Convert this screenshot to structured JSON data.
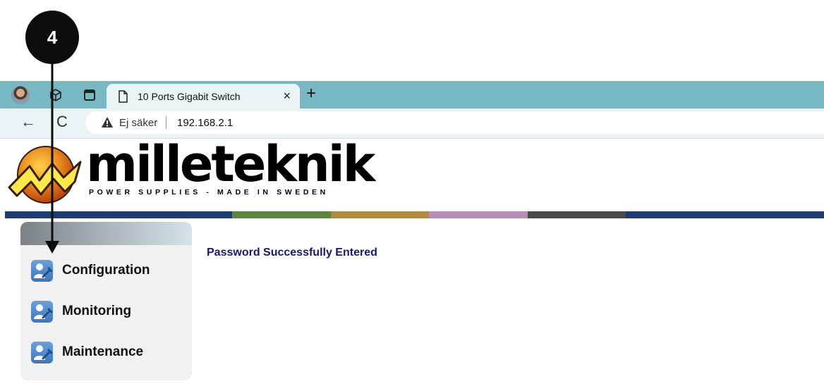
{
  "callout": {
    "step": "4"
  },
  "browser": {
    "tab_title": "10 Ports Gigabit Switch",
    "tab_close": "×",
    "new_tab": "+",
    "back": "←",
    "reload": "C",
    "security_label": "Ej säker",
    "url": "192.168.2.1"
  },
  "brand": {
    "name": "milleteknik",
    "tagline": "POWER SUPPLIES - MADE IN SWEDEN",
    "stripe_colors": [
      "#1d3c71",
      "#5e843f",
      "#b08a3d",
      "#b98bb7",
      "#4a4a4a",
      "#1d3c71"
    ]
  },
  "sidebar": {
    "items": [
      {
        "label": "Configuration",
        "icon": "user-tool-icon"
      },
      {
        "label": "Monitoring",
        "icon": "user-tool-icon"
      },
      {
        "label": "Maintenance",
        "icon": "user-tool-icon"
      }
    ]
  },
  "main": {
    "status": "Password Successfully Entered"
  }
}
